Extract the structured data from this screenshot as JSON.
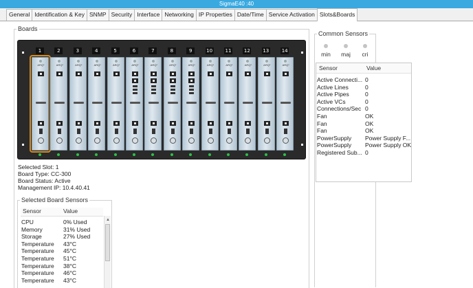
{
  "window": {
    "title": "SigmaE40 :40"
  },
  "tabs": [
    {
      "label": "General"
    },
    {
      "label": "Identification & Key"
    },
    {
      "label": "SNMP"
    },
    {
      "label": "Security"
    },
    {
      "label": "Interface"
    },
    {
      "label": "Networking"
    },
    {
      "label": "IP Properties"
    },
    {
      "label": "Date/Time"
    },
    {
      "label": "Service Activation"
    },
    {
      "label": "Slots&Boards",
      "active": true
    }
  ],
  "boards": {
    "group_title": "Boards",
    "slot_numbers": [
      "1",
      "2",
      "3",
      "4",
      "5",
      "6",
      "7",
      "8",
      "9",
      "10",
      "11",
      "12",
      "13",
      "14"
    ],
    "card_label": "ARQ*",
    "selected_slot_index": 0,
    "selection_color": "#d98a1a"
  },
  "board_info": {
    "selected_slot": "Selected Slot: 1",
    "board_type": "Board Type: CC-300",
    "board_status": "Board Status: Active",
    "management_ip": "Management IP: 10.4.40.41"
  },
  "selected_board_sensors": {
    "title": "Selected Board Sensors",
    "columns": [
      "Sensor",
      "Value"
    ],
    "rows": [
      {
        "sensor": "CPU",
        "value": "0% Used"
      },
      {
        "sensor": "Memory",
        "value": "31% Used"
      },
      {
        "sensor": "Storage",
        "value": "27% Used"
      },
      {
        "sensor": "Temperature",
        "value": "43°C"
      },
      {
        "sensor": "Temperature",
        "value": "45°C"
      },
      {
        "sensor": "Temperature",
        "value": "51°C"
      },
      {
        "sensor": "Temperature",
        "value": "38°C"
      },
      {
        "sensor": "Temperature",
        "value": "46°C"
      },
      {
        "sensor": "Temperature",
        "value": "43°C"
      }
    ]
  },
  "common_sensors": {
    "title": "Common Sensors",
    "alarms": [
      {
        "label": "min"
      },
      {
        "label": "maj"
      },
      {
        "label": "cri"
      }
    ],
    "columns": [
      "Sensor",
      "Value"
    ],
    "rows": [
      {
        "sensor": "Active Connecti...",
        "value": "0"
      },
      {
        "sensor": "Active Lines",
        "value": "0"
      },
      {
        "sensor": "Active Pipes",
        "value": "0"
      },
      {
        "sensor": "Active VCs",
        "value": "0"
      },
      {
        "sensor": "Connections/Sec",
        "value": "0"
      },
      {
        "sensor": "Fan",
        "value": "OK"
      },
      {
        "sensor": "Fan",
        "value": "OK"
      },
      {
        "sensor": "Fan",
        "value": "OK"
      },
      {
        "sensor": "PowerSupply",
        "value": "Power Supply F..."
      },
      {
        "sensor": "PowerSupply",
        "value": "Power Supply OK"
      },
      {
        "sensor": "Registered Sub...",
        "value": "0"
      }
    ]
  },
  "colors": {
    "title_bar": "#3aa9e0",
    "led": "#2cc24a",
    "chassis": "#2a2a2a"
  }
}
